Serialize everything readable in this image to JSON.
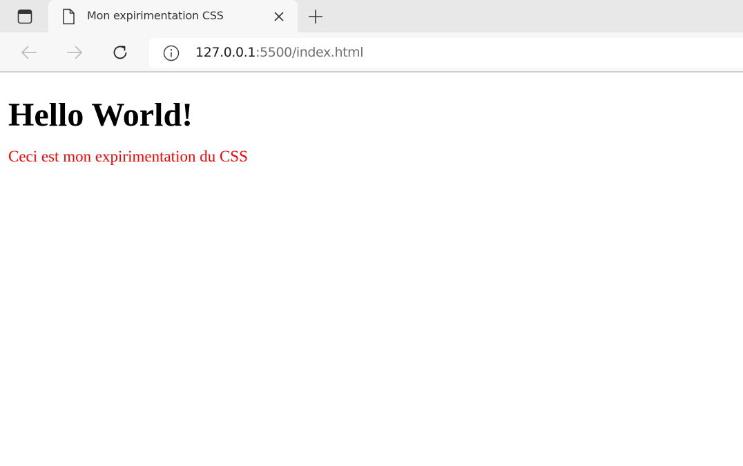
{
  "browser": {
    "tab": {
      "title": "Mon expirimentation CSS"
    },
    "address_bar": {
      "url_host": "127.0.0.1",
      "url_rest": ":5500/index.html"
    },
    "icons": {
      "tab_actions": "tab-actions-icon",
      "page": "page-icon",
      "close": "close-icon",
      "new_tab": "plus-icon",
      "back": "arrow-left-icon",
      "forward": "arrow-right-icon",
      "reload": "reload-icon",
      "site_info": "info-icon"
    }
  },
  "page": {
    "heading": "Hello World!",
    "paragraph": "Ceci est mon expirimentation du CSS",
    "paragraph_color": "#ff0000"
  }
}
